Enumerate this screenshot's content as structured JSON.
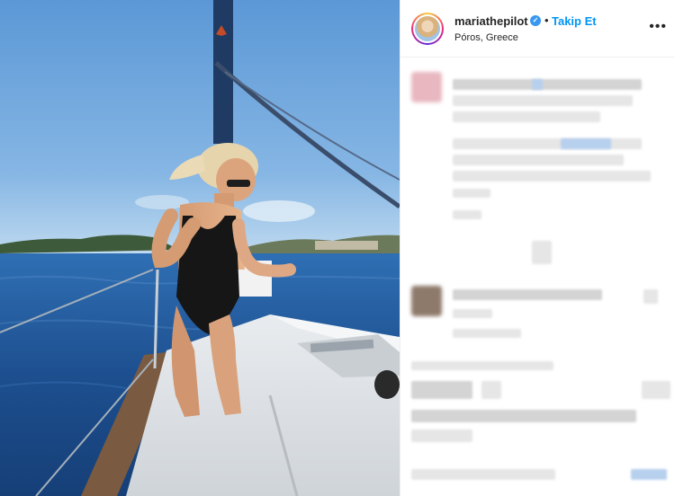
{
  "post": {
    "username": "mariathepilot",
    "verified_mark": "✓",
    "separator": "•",
    "follow_label": "Takip Et",
    "location": "Póros, Greece",
    "more_label": "•••"
  },
  "icons": {
    "verified": "verified-badge-icon",
    "more": "more-options-icon",
    "avatar": "profile-avatar"
  },
  "colors": {
    "follow": "#0095f6",
    "verified": "#3897f0",
    "text": "#262626"
  }
}
